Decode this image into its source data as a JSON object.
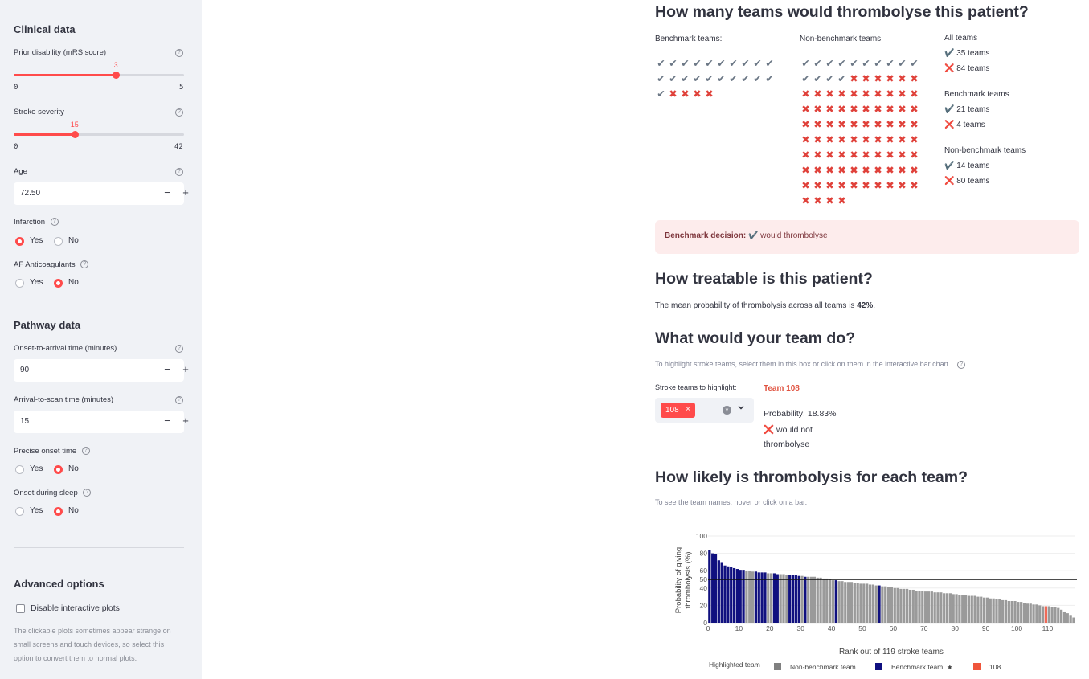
{
  "sidebar": {
    "clinical_heading": "Clinical data",
    "prior_disability": {
      "label": "Prior disability (mRS score)",
      "value": 3,
      "min": 0,
      "max": 5
    },
    "stroke_severity": {
      "label": "Stroke severity",
      "value": 15,
      "min": 0,
      "max": 42
    },
    "age": {
      "label": "Age",
      "value": "72.50"
    },
    "infarction": {
      "label": "Infarction",
      "options": [
        "Yes",
        "No"
      ],
      "selected": "Yes"
    },
    "af_anticoagulants": {
      "label": "AF Anticoagulants",
      "options": [
        "Yes",
        "No"
      ],
      "selected": "No"
    },
    "pathway_heading": "Pathway data",
    "onset_to_arrival": {
      "label": "Onset-to-arrival time (minutes)",
      "value": "90"
    },
    "arrival_to_scan": {
      "label": "Arrival-to-scan time (minutes)",
      "value": "15"
    },
    "precise_onset": {
      "label": "Precise onset time",
      "options": [
        "Yes",
        "No"
      ],
      "selected": "No"
    },
    "onset_during_sleep": {
      "label": "Onset during sleep",
      "options": [
        "Yes",
        "No"
      ],
      "selected": "No"
    },
    "advanced_heading": "Advanced options",
    "disable_plots": {
      "label": "Disable interactive plots",
      "checked": false
    },
    "disable_plots_note": "The clickable plots sometimes appear strange on small screens and touch devices, so select this option to convert them to normal plots.",
    "help_glyph": "?",
    "minus_glyph": "−",
    "plus_glyph": "+"
  },
  "main": {
    "q1_title": "How many teams would thrombolyse this patient?",
    "benchmark_label": "Benchmark teams:",
    "nonbenchmark_label": "Non-benchmark teams:",
    "benchmark_counts": {
      "yes": 21,
      "no": 4
    },
    "nonbenchmark_counts": {
      "yes": 14,
      "no": 80
    },
    "summary": {
      "all_heading": "All teams",
      "all_yes": "✔️ 35 teams",
      "all_no": "❌ 84 teams",
      "bench_heading": "Benchmark teams",
      "bench_yes": "✔️ 21 teams",
      "bench_no": "❌ 4 teams",
      "nonbench_heading": "Non-benchmark teams",
      "nonbench_yes": "✔️ 14 teams",
      "nonbench_no": "❌ 80 teams"
    },
    "benchmark_decision_label": "Benchmark decision:",
    "benchmark_decision_value": "✔️ would thrombolyse",
    "q2_title": "How treatable is this patient?",
    "q2_text_pre": "The mean probability of thrombolysis across all teams is ",
    "q2_text_value": "42%",
    "q2_text_post": ".",
    "q3_title": "What would your team do?",
    "q3_caption": "To highlight stroke teams, select them in this box or click on them in the interactive bar chart.",
    "highlight_label": "Stroke teams to highlight:",
    "highlight_chip": "108",
    "chip_remove": "×",
    "team_name": "Team 108",
    "team_probability": "Probability: 18.83%",
    "team_decision_line1": "❌ would not",
    "team_decision_line2": "thrombolyse",
    "q4_title": "How likely is thrombolysis for each team?",
    "q4_caption": "To see the team names, hover or click on a bar."
  },
  "chart_data": {
    "type": "bar",
    "ylabel_line1": "Probability of giving",
    "ylabel_line2": "thrombolysis (%)",
    "xlabel": "Rank out of 119 stroke teams",
    "ylim": [
      0,
      100
    ],
    "xlim": [
      0,
      119
    ],
    "yticks": [
      0,
      20,
      40,
      50,
      60,
      80,
      100
    ],
    "xticks": [
      0,
      10,
      20,
      30,
      40,
      50,
      60,
      70,
      80,
      90,
      100,
      110
    ],
    "threshold_line": 50,
    "legend_title": "Highlighted team",
    "legend": [
      {
        "name": "Non-benchmark team",
        "color": "#808080"
      },
      {
        "name": "Benchmark team: ★",
        "color": "#0f0f80"
      },
      {
        "name": "108",
        "color": "#ef553b"
      }
    ],
    "colors": {
      "nonbenchmark": "#9a9a9a",
      "benchmark": "#10107f",
      "highlight": "#ef6a58"
    },
    "benchmark_ranks": [
      1,
      2,
      3,
      4,
      5,
      6,
      7,
      8,
      9,
      10,
      11,
      12,
      16,
      17,
      18,
      19,
      22,
      23,
      27,
      28,
      29,
      30,
      32,
      42,
      56
    ],
    "highlight_rank": 110,
    "values": [
      84,
      80,
      79,
      72,
      69,
      66,
      65,
      64,
      63,
      62,
      61,
      61,
      60,
      60,
      59,
      59,
      58,
      58,
      58,
      57,
      57,
      57,
      56,
      56,
      56,
      55,
      55,
      55,
      55,
      54,
      54,
      53,
      53,
      53,
      53,
      52,
      52,
      51,
      51,
      50,
      49,
      49,
      48,
      48,
      47,
      47,
      47,
      46,
      46,
      45,
      45,
      45,
      44,
      44,
      43,
      43,
      42,
      42,
      41,
      41,
      40,
      40,
      39,
      39,
      39,
      38,
      38,
      37,
      37,
      37,
      36,
      36,
      36,
      35,
      35,
      35,
      34,
      34,
      34,
      33,
      33,
      32,
      32,
      32,
      31,
      31,
      31,
      30,
      30,
      29,
      29,
      28,
      28,
      27,
      27,
      26,
      26,
      25,
      25,
      25,
      24,
      24,
      23,
      22,
      22,
      21,
      21,
      20,
      19,
      19,
      19,
      18,
      18,
      17,
      15,
      13,
      11,
      9,
      6
    ]
  }
}
